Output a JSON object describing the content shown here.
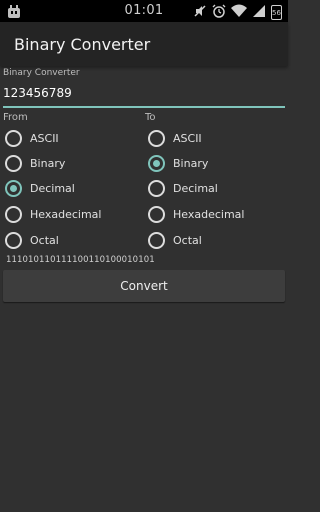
{
  "status_bar": {
    "time": "01:01",
    "battery": "56",
    "icons": [
      "cyanogen-icon",
      "mute-icon",
      "alarm-icon",
      "wifi-icon",
      "signal-icon",
      "battery-icon"
    ]
  },
  "app": {
    "title": "Binary Converter"
  },
  "input": {
    "label": "Binary Converter",
    "value": "123456789"
  },
  "from": {
    "label": "From",
    "options": [
      "ASCII",
      "Binary",
      "Decimal",
      "Hexadecimal",
      "Octal"
    ],
    "selected": "Decimal"
  },
  "to": {
    "label": "To",
    "options": [
      "ASCII",
      "Binary",
      "Decimal",
      "Hexadecimal",
      "Octal"
    ],
    "selected": "Binary"
  },
  "result": "111010110111100110100010101",
  "convert_label": "Convert",
  "colors": {
    "accent": "#7fc4bb",
    "background": "#303030",
    "action_bar": "#242424"
  }
}
